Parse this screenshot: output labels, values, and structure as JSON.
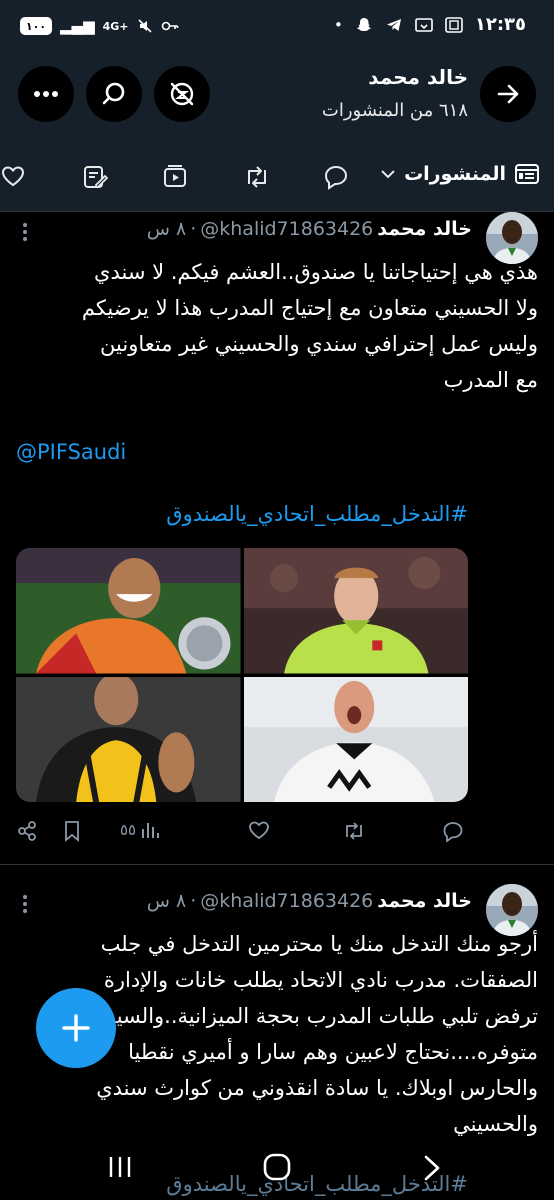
{
  "status_bar": {
    "time": "١٢:٣٥",
    "battery": "١٠٠",
    "network": "4G+"
  },
  "header": {
    "name": "خالد محمد",
    "posts_count": "٦١٨ من المنشورات",
    "icons": [
      "back-arrow-icon",
      "no-notifications-icon",
      "search-icon",
      "more-icon"
    ]
  },
  "tabs": {
    "active_label": "المنشورات",
    "icons": [
      "posts-icon",
      "chevron-down-icon",
      "reply-icon",
      "repost-icon",
      "media-icon",
      "articles-icon",
      "likes-icon"
    ]
  },
  "posts": [
    {
      "name": "خالد محمد",
      "handle": "@khalid71863426",
      "time": "٨ س",
      "lines": [
        "هذي هي إحتياجاتنا يا صندوق..العشم فيكم. لا سندي",
        "ولا الحسيني متعاون مع إحتياج المدرب هذا لا يرضيكم",
        "وليس عمل إحترافي سندي والحسيني غير متعاونين",
        "مع المدرب"
      ],
      "mention": "@PIFSaudi",
      "hashtag": "#التدخل_مطلب_اتحادي_يالصندوق",
      "views": "٥٥",
      "images": [
        "goalkeeper-green-jersey",
        "player-with-trophy",
        "player-white-jersey",
        "player-yellow-black-jersey"
      ]
    },
    {
      "name": "خالد محمد",
      "handle": "@khalid71863426",
      "time": "٨ س",
      "lines": [
        "أرجو منك التدخل منك يا محترمين التدخل في جلب",
        "الصفقات. مدرب نادي الاتحاد يطلب خانات والإدارة",
        "ترفض تلبي طلبات المدرب بحجة الميزانية..والسيولة",
        "متوفره....نحتاج لاعبين وهم سارا و أميري نقطيا",
        "والحارس اوبلاك. يا سادة انقذوني من كوارث سندي",
        "والحسيني"
      ],
      "hashtag": "#التدخل_مطلب_اتحادي_يالصندوق"
    }
  ],
  "colors": {
    "background": "#000000",
    "header_bg": "#15202b",
    "accent": "#1d9bf0",
    "muted": "#8b98a5"
  }
}
